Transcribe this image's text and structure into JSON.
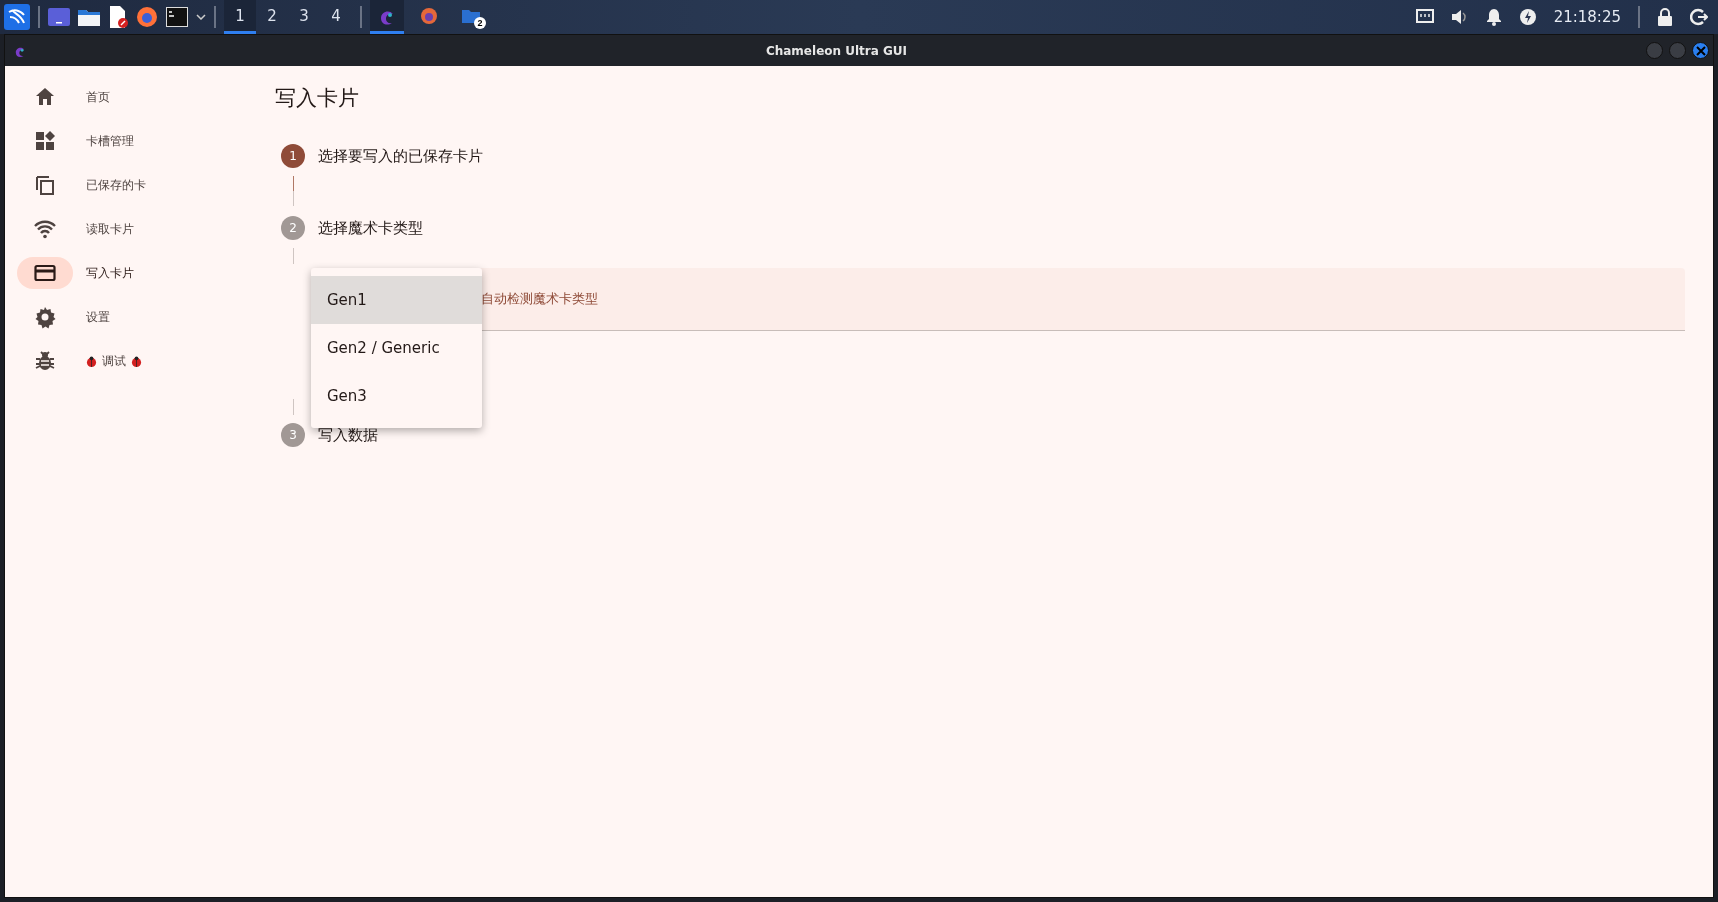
{
  "taskbar": {
    "workspaces": [
      {
        "label": "1",
        "selected": true
      },
      {
        "label": "2",
        "selected": false
      },
      {
        "label": "3",
        "selected": false
      },
      {
        "label": "4",
        "selected": false
      }
    ],
    "tasks": [
      {
        "kind": "chameleon",
        "selected": true
      },
      {
        "kind": "browser",
        "selected": false
      },
      {
        "kind": "folder",
        "selected": false,
        "badge": "2"
      }
    ],
    "clock": "21:18:25"
  },
  "window": {
    "title": "Chameleon Ultra GUI"
  },
  "sidebar": {
    "items": [
      {
        "kind": "home",
        "label": "首页",
        "selected": false
      },
      {
        "kind": "dashboard",
        "label": "卡槽管理",
        "selected": false
      },
      {
        "kind": "copy",
        "label": "已保存的卡",
        "selected": false
      },
      {
        "kind": "wifi",
        "label": "读取卡片",
        "selected": false
      },
      {
        "kind": "card",
        "label": "写入卡片",
        "selected": true
      },
      {
        "kind": "gear",
        "label": "设置",
        "selected": false
      },
      {
        "kind": "bug",
        "label": "调试",
        "selected": false,
        "bug_marks": true
      }
    ]
  },
  "page": {
    "title": "写入卡片",
    "steps": [
      {
        "number": "1",
        "label": "选择要写入的已保存卡片",
        "active": true
      },
      {
        "number": "2",
        "label": "选择魔术卡类型",
        "active": false,
        "field": {
          "value": "自动检测魔术卡类型"
        },
        "menu": {
          "items": [
            {
              "label": "Gen1",
              "selected": true
            },
            {
              "label": "Gen2 / Generic",
              "selected": false
            },
            {
              "label": "Gen3",
              "selected": false
            }
          ]
        }
      },
      {
        "number": "3",
        "label": "写入数据",
        "active": false
      }
    ]
  }
}
